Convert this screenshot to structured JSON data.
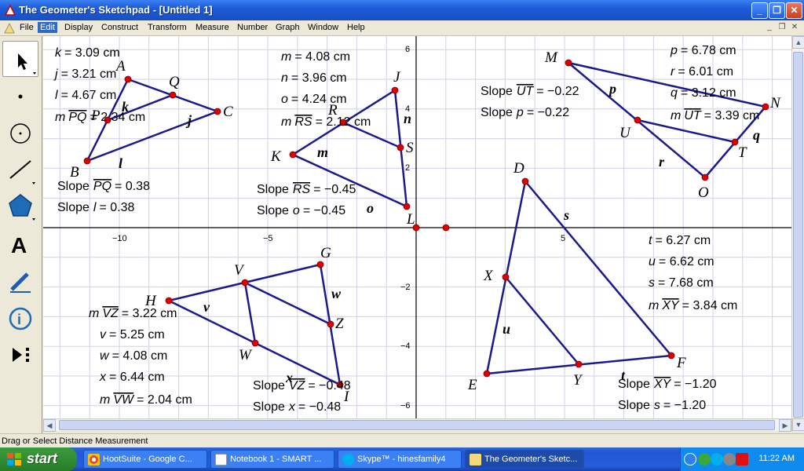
{
  "window": {
    "title": "The Geometer's Sketchpad - [Untitled 1]"
  },
  "menu": [
    "File",
    "Edit",
    "Display",
    "Construct",
    "Transform",
    "Measure",
    "Number",
    "Graph",
    "Window",
    "Help"
  ],
  "menu_active": "Edit",
  "tools": [
    "arrow-select-tool",
    "point-tool",
    "compass-tool",
    "straightedge-tool",
    "polygon-tool",
    "text-tool",
    "marker-tool",
    "information-tool",
    "custom-tools-tool"
  ],
  "status": "Drag or Select Distance Measurement",
  "axes": {
    "x_ticks": [
      "−10",
      "−5",
      "5"
    ],
    "y_ticks": [
      "6",
      "4",
      "2",
      "−2",
      "−4",
      "−6"
    ],
    "y_tick_values": [
      6,
      4,
      2,
      -2,
      -4,
      -6
    ],
    "x_tick_values": [
      -10,
      -5,
      5
    ]
  },
  "sketch": {
    "point_labels": {
      "A": "A",
      "B": "B",
      "C": "C",
      "P": "P",
      "Q": "Q",
      "J": "J",
      "K": "K",
      "L": "L",
      "R": "R",
      "S": "S",
      "M": "M",
      "N": "N",
      "O": "O",
      "U": "U",
      "T": "T",
      "D": "D",
      "E": "E",
      "F": "F",
      "X": "X",
      "Y": "Y",
      "G": "G",
      "H": "H",
      "I": "I",
      "V": "V",
      "W": "W",
      "Z": "Z"
    },
    "segment_labels": {
      "k": "k",
      "j": "j",
      "l": "l",
      "m": "m",
      "n": "n",
      "o": "o",
      "p": "p",
      "q": "q",
      "r": "r",
      "s": "s",
      "t": "t",
      "u": "u",
      "v": "v",
      "w": "w",
      "x": "x"
    }
  },
  "measurements": {
    "tri1": {
      "k": "= 3.09 cm",
      "j": "= 3.21 cm",
      "l": "= 4.67 cm",
      "mPQ": "= 2.34 cm",
      "slopePQ": "= 0.38",
      "slopel": "= 0.38"
    },
    "tri2": {
      "m": "= 4.08 cm",
      "n": "= 3.96 cm",
      "o": "= 4.24 cm",
      "mRS": "= 2.12 cm",
      "slopeRS": "= −0.45",
      "slopeo": "= −0.45"
    },
    "tri3": {
      "p": "= 6.78 cm",
      "r": "= 6.01 cm",
      "q": "= 3.12 cm",
      "mUT": "= 3.39 cm",
      "slopeUT": "= −0.22",
      "slopep": "= −0.22"
    },
    "tri4": {
      "t": "= 6.27 cm",
      "u": "= 6.62 cm",
      "s": "= 7.68 cm",
      "mXY": "= 3.84 cm",
      "slopeXY": "= −1.20",
      "slopes": "= −1.20"
    },
    "tri5": {
      "mVZ": "= 3.22 cm",
      "v": "= 5.25 cm",
      "w": "= 4.08 cm",
      "x": "= 6.44 cm",
      "mVW": "= 2.04 cm",
      "slopeVZ": "= −0.48",
      "slopex": "= −0.48"
    }
  },
  "measure_words": {
    "m": "m",
    "slope": "Slope"
  },
  "taskbar": {
    "start": "start",
    "tasks": [
      "HootSuite - Google C...",
      "Notebook 1 - SMART ...",
      "Skype™ - hinesfamily4",
      "The Geometer's Sketc..."
    ],
    "clock": "11:22 AM"
  },
  "colors": {
    "accent": "#1a1a8c",
    "point": "#e00000",
    "grid": "#cfcfe8"
  }
}
